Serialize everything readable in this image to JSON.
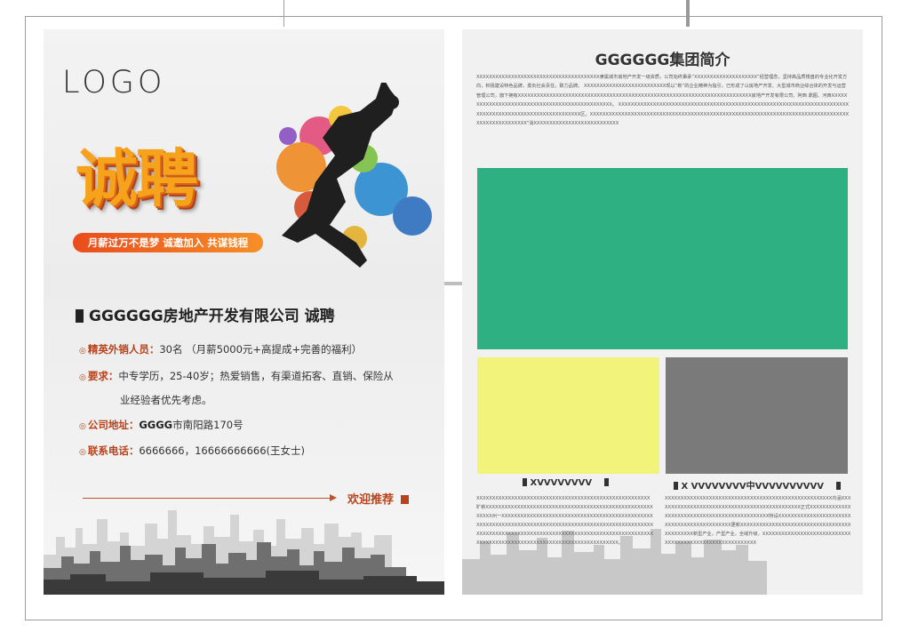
{
  "left_page": {
    "logo": "LOGO",
    "headline": "诚聘",
    "slogan": "月薪过万不是梦 诚邀加入 共谋钱程",
    "company": "GGGGGG房地产开发有限公司 诚聘",
    "position_label": "精英外销人员：",
    "position_value": "30名 （月薪5000元+高提成+完善的福利）",
    "requirement_label": "要求：",
    "requirement_line1": "中专学历，25-40岁；热爱销售，有渠道拓客、直销、保险从",
    "requirement_line2": "业经验者优先考虑。",
    "address_label": "公司地址：",
    "address_bold": "GGGG",
    "address_value": "市南阳路170号",
    "phone_label": "联系电话：",
    "phone_value": "6666666，16666666666(王女士)",
    "welcome": "欢迎推荐"
  },
  "right_page": {
    "title": "GGGGGG集团简介",
    "paragraph": "XXXXXXXXXXXXXXXXXXXXXXXXXXXXXXXXXXXXXXX隶属城市房地产开发一级资质，公司始终秉承“XXXXXXXXXXXXXXXXXXXX”经营理念，坚持高品质楼盘的专业化开发方向，积极建设特色品牌，勇负社会责任，致力品牌。 XXXXXXXXXXXXXXXXXXXXXXXXXX现以“新”的企业精神为指引，已形成了以房地产开发、大型城市商业综合体的开发与运营管理公司，旗下拥有XXXXXXXXXXXXXXXXXXXXXXXXXXXXXXXXXXXXXXXXXXXXXXXXXXXXXXXXXXXXXXXXXXXXXXXXXX房地产开发有限公司、阿西 鼎图、河西XXXXXXXXXXXXXXXXXXXXXXXXXXXXXXXXXXXXXXXXXXXXXXXX。 XXXXXXXXXXXXXXXXXXXXXXXXXXXXXXXXXXXXXXXXXXXXXXXXXXXXXXXXXXXXXXXXXXXXXXXXXXXXXXXXXXXXXXXXXXXXXXXXXXXXXXXXXX区。XXXXXXXXXXXXXXXXXXXXXXXXXXXXXXXXXXXXXXXXXXXXXXXXXXXXXXXXXXXXXXXXXXXXXXXXXXXXXXXXXXXXXXXXXXXXXXXXXX“消XXXXXXXXXXXXXXXXXXXXXXXXXXX",
    "caption_left": "XVVVVVVVV",
    "caption_right": "X  VVVVVVVV中VVVVVVVVVV",
    "text_left": "XXXXXXXXXXXXXXXXXXXXXXXXXXXXXXXXXXXXXXXXXXXXXXXXXXXXXXX旷新XXXXXXXXXXXXXXXXXXXXXXXXXXXXXXXXXXXXXXXXXXXXXXXXXXXXXXXXXX州一XXXXXXXXXXXXXXXXXXXXXXXXXXXXXXXXXXXXXXXXXXXXXXXXXXXXXXXXXXXXXXXXXXXXXXXXXXXXXXXXXXXXXXXXXXXXXXXXXXXXXXXXXXXXXXXXXXXXXXXXXXXXXXXXXXXXXXXXXXXXXXXXXXXXXXXXXXXXXXXXXXXXXXXXXXXXXXXXXXXXXXXXXXXXXXXXXXXXXXXXXXXXX。",
    "text_right": "XXXXXXXXXXXXXXXXXXXXXXXXXXXXXXXXXXXXXXXXXXXXXXXXXXXXX内涵XXXXXXXXXXXXXXXXXXXXXXXXXXXXXXXXXXXXXXXXXXXXXX正式XXXXXXXXXXXXXXXXXXXXXXXXXXXXXXXXXXXXXXXXXXXXXX特设XXXXXXXXXXXXXXXXXXXXXXXXXXXXXXXXXXXXXXXXXXXX更新XXXXXXXXXXXXXXXXXXXXXXXXXXXXXXXXXXXXXXXXXXXX新型产业，产型产业，全域升级，XXXXXXXXXXXXXXXXXXXXXXXXXXXXXXXXXXXXXXXXXXXXXXXXXXXXXXXXX"
  },
  "colors": {
    "accent": "#b8421b",
    "green_block": "#2eb082",
    "yellow_block": "#f1f37a",
    "gray_block": "#7a7a7a"
  }
}
